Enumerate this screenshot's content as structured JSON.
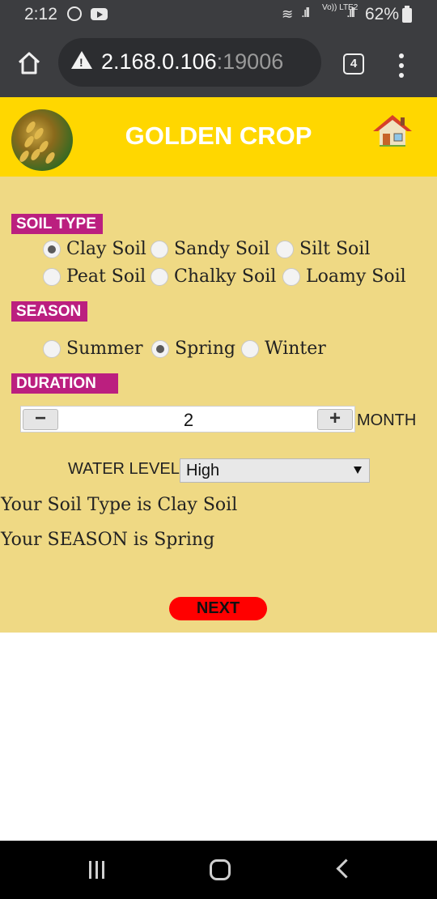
{
  "status_bar": {
    "time": "2:12",
    "battery": "62%",
    "network": "Vo)) LTE2"
  },
  "browser": {
    "url_host": "2.168.0.106",
    "url_port": ":19006",
    "tab_count": "4"
  },
  "header": {
    "title": "GOLDEN CROP"
  },
  "soil": {
    "label": "SOIL TYPE",
    "options": [
      "Clay Soil",
      "Sandy Soil",
      "Silt Soil",
      "Peat Soil",
      "Chalky Soil",
      "Loamy Soil"
    ],
    "selected": "Clay Soil"
  },
  "season": {
    "label": "SEASON",
    "options": [
      "Summer",
      "Spring",
      "Winter"
    ],
    "selected": "Spring"
  },
  "duration": {
    "label": "DURATION",
    "minus": "−",
    "plus": "+",
    "value": "2",
    "unit": "MONTH"
  },
  "water": {
    "label": "WATER LEVEL:",
    "selected": "High"
  },
  "results": {
    "soil_line": "Your Soil Type is Clay Soil",
    "season_line": "Your SEASON is Spring"
  },
  "actions": {
    "next": "NEXT"
  },
  "colors": {
    "header_bg": "#ffd700",
    "form_bg": "#efd984",
    "tag_bg": "#bb1f7f",
    "next_bg": "#ff0000"
  }
}
